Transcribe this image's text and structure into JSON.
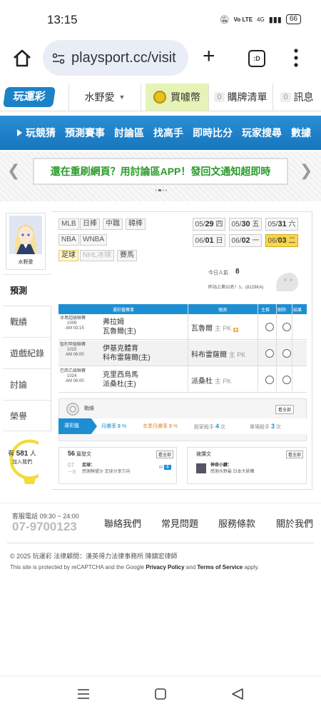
{
  "status": {
    "time": "13:15",
    "net": "4G",
    "battery": "66",
    "volte": "Vo LTE"
  },
  "browser": {
    "url": "playsport.cc/visit",
    "tabs_label": ":D"
  },
  "header": {
    "logo": "玩運彩",
    "user": "水野愛",
    "coins": "買噱幣",
    "cart_count": "0",
    "cart": "購牌清單",
    "msg_count": "0",
    "msg": "訊息"
  },
  "nav": [
    "玩競猜",
    "預測賽事",
    "討論區",
    "找高手",
    "即時比分",
    "玩家搜尋",
    "數據"
  ],
  "banner": {
    "text": "還在重刷網頁？用討論區APP！發回文通知超即時"
  },
  "profile": {
    "name": "水野愛"
  },
  "sidebar": [
    "預測",
    "戰績",
    "遊戲紀錄",
    "討論",
    "榮譽"
  ],
  "helper": {
    "prefix": "有",
    "count": "581",
    "suffix": "人",
    "line2": "加入我們"
  },
  "leagues": [
    "MLB",
    "日棒",
    "中職",
    "韓棒",
    "NBA",
    "WNBA",
    "足球",
    "NHL冰球",
    "賽馬"
  ],
  "dates": [
    {
      "md": "05/",
      "d": "29",
      "w": "四"
    },
    {
      "md": "05/",
      "d": "30",
      "w": "五"
    },
    {
      "md": "05/",
      "d": "31",
      "w": "六"
    },
    {
      "md": "06/",
      "d": "01",
      "w": "日"
    },
    {
      "md": "06/",
      "d": "02",
      "w": "一"
    },
    {
      "md": "06/",
      "d": "03",
      "w": "二"
    }
  ],
  "today": {
    "label": "今日人氣",
    "value": "8",
    "rank": "昨站上第32名！1、(8129KA)"
  },
  "table": {
    "headers": [
      "運彩盤賽事",
      "預測",
      "主推",
      "刪除",
      "結果"
    ],
    "rows": [
      {
        "league": "冰島超級聯賽",
        "num": "1009",
        "time": "AM 03:15",
        "team1": "弗拉姆",
        "team2": "瓦魯爾(主)",
        "pick": "瓦魯爾",
        "pk": "主 PK"
      },
      {
        "league": "智利甲級聯賽",
        "num": "1015",
        "time": "AM 06:00",
        "team1": "伊基克體育",
        "team2": "科布雷薩爾(主)",
        "pick": "科布雷薩爾",
        "pk": "主 PK"
      },
      {
        "league": "巴西乙級聯賽",
        "num": "1024",
        "time": "AM 06:00",
        "team1": "克里西烏馬",
        "team2": "派桑杜(主)",
        "pick": "派桑杜",
        "pk": "主 PK"
      }
    ]
  },
  "stats": {
    "title": "戰績",
    "more": "看全部",
    "items": [
      "運彩盤",
      "月勝率",
      "0",
      "%",
      "本季月勝率",
      "0",
      "%",
      "殺家殺手",
      "4",
      "次",
      "單場殺手",
      "3",
      "次"
    ]
  },
  "cards": {
    "left": {
      "count": "56",
      "title": "篇發文",
      "more": "看全部",
      "date": "07",
      "sub": "一台",
      "tag": "足球：",
      "text": "感謝聯盟沙 足球分享方向",
      "reply": "4"
    },
    "right": {
      "title": "被讚文",
      "more": "看全部",
      "user": "神奇小鍵：",
      "text": "感謝水野最 日本大師團"
    }
  },
  "footer": {
    "service": "客服電話 09:30 ~ 24:00",
    "phone": "07-9700123",
    "links": [
      "聯絡我們",
      "常見問題",
      "服務條款",
      "關於我們"
    ],
    "copyright": "© 2025 玩運彩 法律顧問：漢英得力法律事務所 陳鎮宏律師",
    "captcha_pre": "This site is protected by reCAPTCHA and the Google ",
    "privacy": "Privacy Policy",
    "and": " and ",
    "terms": "Terms of Service",
    "apply": " apply."
  },
  "colors": {
    "accent": "#1e8ed3",
    "coins_bg": "#e5f3b6",
    "highlight": "#f9d64a",
    "banner_text": "#2a9b2a"
  }
}
